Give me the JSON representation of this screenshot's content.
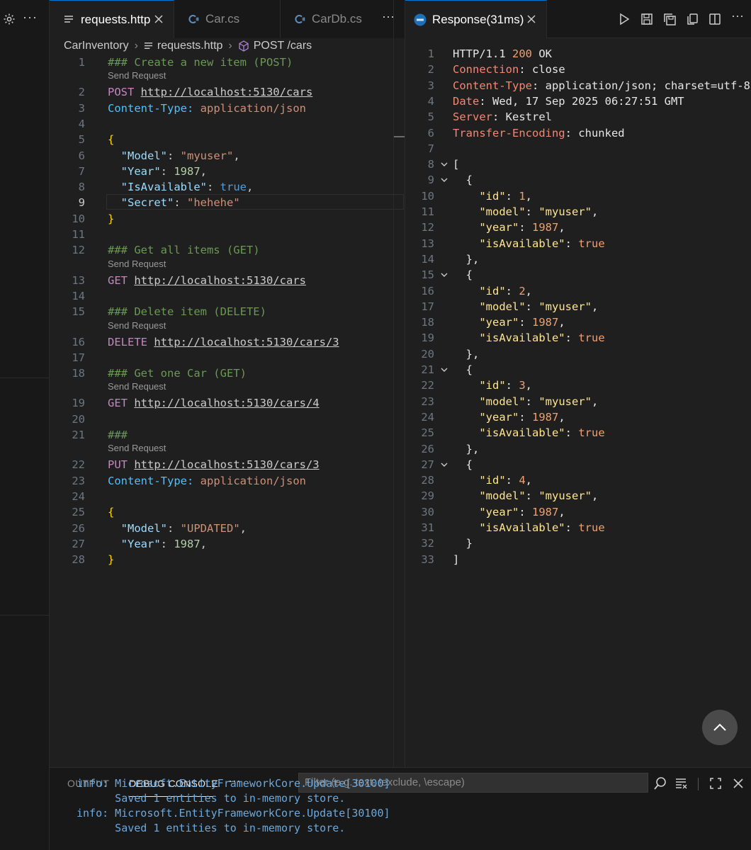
{
  "tabs": {
    "left": [
      {
        "label": "requests.http",
        "active": true
      },
      {
        "label": "Car.cs",
        "active": false
      },
      {
        "label": "CarDb.cs",
        "active": false
      }
    ],
    "right": [
      {
        "label": "Response(31ms)",
        "active": true
      }
    ]
  },
  "breadcrumb": [
    "CarInventory",
    "requests.http",
    "POST /cars"
  ],
  "codelens_label": "Send Request",
  "editor": {
    "current_line": 9,
    "lines": [
      "### Create a new item (POST)",
      "POST http://localhost:5130/cars",
      "Content-Type: application/json",
      "",
      "{",
      "  \"Model\": \"myuser\",",
      "  \"Year\": 1987,",
      "  \"IsAvailable\": true,",
      "  \"Secret\": \"hehehe\"",
      "}",
      "",
      "### Get all items (GET)",
      "GET http://localhost:5130/cars",
      "",
      "### Delete item (DELETE)",
      "DELETE http://localhost:5130/cars/3",
      "",
      "### Get one Car (GET)",
      "GET http://localhost:5130/cars/4",
      "",
      "###",
      "PUT http://localhost:5130/cars/3",
      "Content-Type: application/json",
      "",
      "{",
      "  \"Model\": \"UPDATED\",",
      "  \"Year\": 1987,",
      "}"
    ]
  },
  "response": {
    "lines": [
      "HTTP/1.1 200 OK",
      "Connection: close",
      "Content-Type: application/json; charset=utf-8",
      "Date: Wed, 17 Sep 2025 06:27:51 GMT",
      "Server: Kestrel",
      "Transfer-Encoding: chunked",
      "",
      "[",
      "  {",
      "    \"id\": 1,",
      "    \"model\": \"myuser\",",
      "    \"year\": 1987,",
      "    \"isAvailable\": true",
      "  },",
      "  {",
      "    \"id\": 2,",
      "    \"model\": \"myuser\",",
      "    \"year\": 1987,",
      "    \"isAvailable\": true",
      "  },",
      "  {",
      "    \"id\": 3,",
      "    \"model\": \"myuser\",",
      "    \"year\": 1987,",
      "    \"isAvailable\": true",
      "  },",
      "  {",
      "    \"id\": 4,",
      "    \"model\": \"myuser\",",
      "    \"year\": 1987,",
      "    \"isAvailable\": true",
      "  }",
      "]"
    ]
  },
  "panel": {
    "tabs": [
      {
        "label": "OUTPUT",
        "active": false
      },
      {
        "label": "DEBUG CONSOLE",
        "active": true
      }
    ],
    "filter_placeholder": "Filter (e.g. text, !exclude, \\escape)",
    "console_lines": [
      "info: Microsoft.EntityFrameworkCore.Update[30100]",
      "      Saved 1 entities to in-memory store.",
      "info: Microsoft.EntityFrameworkCore.Update[30100]",
      "      Saved 1 entities to in-memory store."
    ]
  },
  "colors": {
    "background": "#1f1f1f",
    "accent": "#0078d4",
    "comment": "#6a9955",
    "method": "#c586c0",
    "json_key": "#9cdcfe",
    "json_string": "#ce9178",
    "response_header": "#f48771"
  }
}
